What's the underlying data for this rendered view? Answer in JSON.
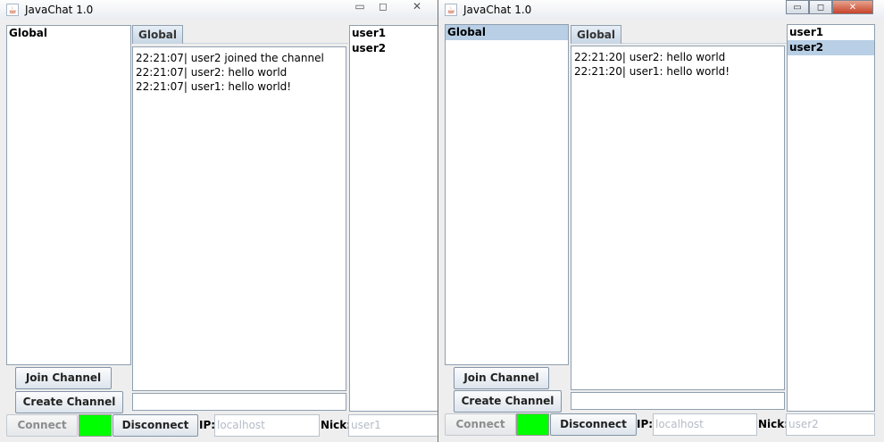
{
  "windows": [
    {
      "title": "JavaChat 1.0",
      "channels": [
        "Global"
      ],
      "selected_channel_highlight": false,
      "tab_label": "Global",
      "messages": [
        "22:21:07| user2 joined the channel",
        "22:21:07| user2: hello world",
        "22:21:07| user1: hello world!"
      ],
      "users": [
        "user1",
        "user2"
      ],
      "join_label": "Join Channel",
      "create_label": "Create Channel",
      "connect_label": "Connect",
      "disconnect_label": "Disconnect",
      "ip_label": "IP:",
      "ip_value": "localhost",
      "nick_label": "Nick:",
      "nick_value": "user1",
      "status_color": "#00ff00"
    },
    {
      "title": "JavaChat 1.0",
      "channels": [
        "Global"
      ],
      "selected_channel_highlight": true,
      "tab_label": "Global",
      "messages": [
        "22:21:20| user2: hello world",
        "22:21:20| user1: hello world!"
      ],
      "users": [
        "user1",
        "user2"
      ],
      "selected_user": "user2",
      "join_label": "Join Channel",
      "create_label": "Create Channel",
      "connect_label": "Connect",
      "disconnect_label": "Disconnect",
      "ip_label": "IP:",
      "ip_value": "localhost",
      "nick_label": "Nick:",
      "nick_value": "user2",
      "status_color": "#00ff00"
    }
  ],
  "icons": {
    "app": "java-cup-icon",
    "minimize": "minimize-icon",
    "maximize": "maximize-icon",
    "close": "close-icon"
  },
  "glyphs": {
    "app": "☕",
    "minimize": "▭",
    "maximize": "◻",
    "close": "✕"
  }
}
